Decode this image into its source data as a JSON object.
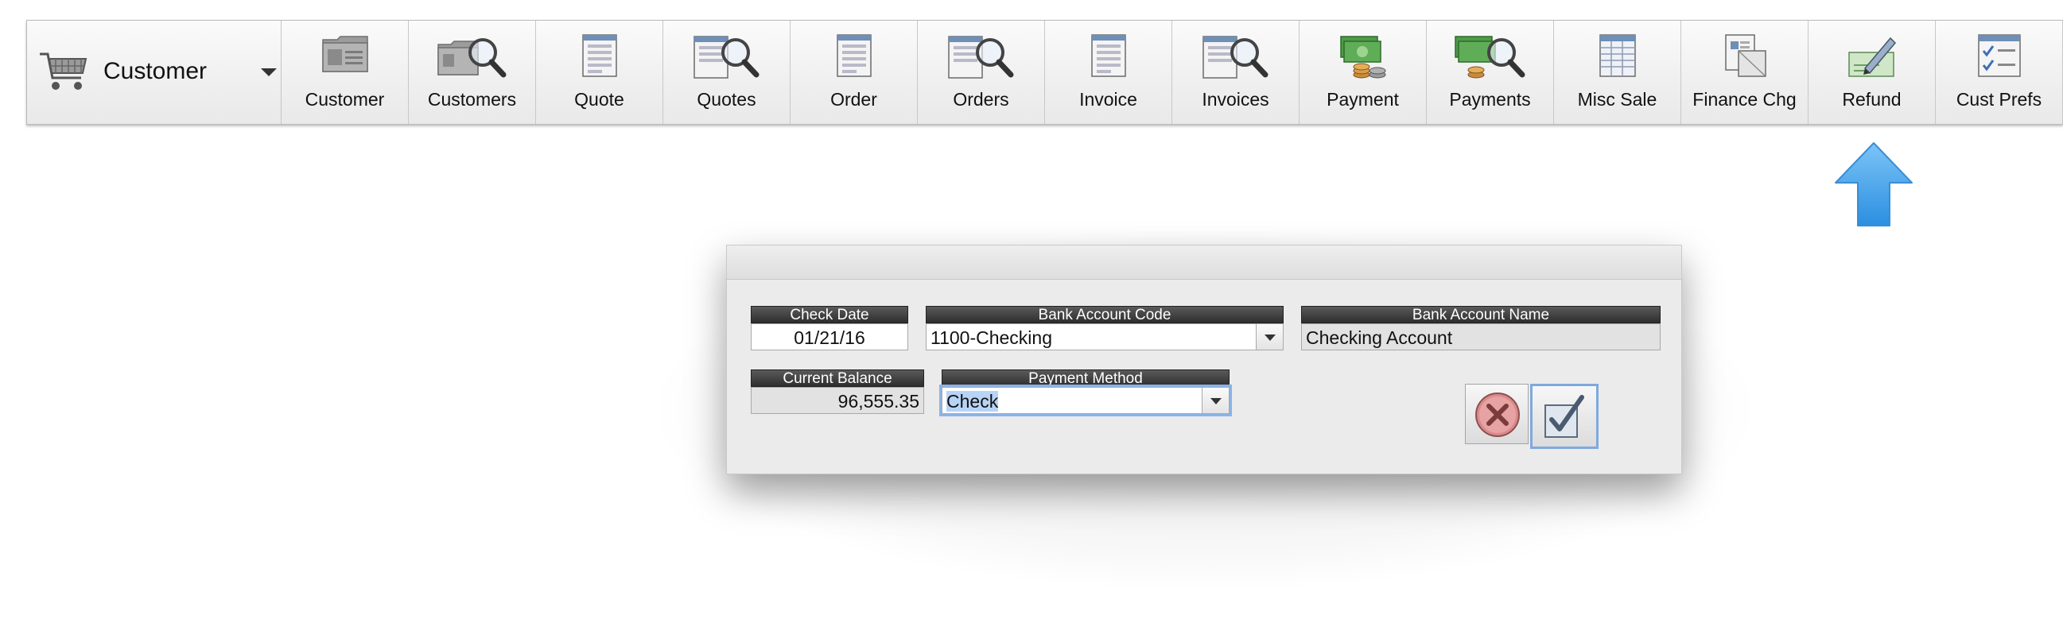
{
  "toolbar": {
    "module": {
      "label": "Customer",
      "icon": "shopping-cart-icon"
    },
    "tools": [
      {
        "label": "Customer",
        "icon": "customer-card-icon"
      },
      {
        "label": "Customers",
        "icon": "customers-search-icon"
      },
      {
        "label": "Quote",
        "icon": "quote-document-icon"
      },
      {
        "label": "Quotes",
        "icon": "quotes-search-icon"
      },
      {
        "label": "Order",
        "icon": "order-document-icon"
      },
      {
        "label": "Orders",
        "icon": "orders-search-icon"
      },
      {
        "label": "Invoice",
        "icon": "invoice-document-icon"
      },
      {
        "label": "Invoices",
        "icon": "invoices-search-icon"
      },
      {
        "label": "Payment",
        "icon": "payment-money-icon"
      },
      {
        "label": "Payments",
        "icon": "payments-search-icon"
      },
      {
        "label": "Misc Sale",
        "icon": "misc-sale-icon"
      },
      {
        "label": "Finance Chg",
        "icon": "finance-charge-icon"
      },
      {
        "label": "Refund",
        "icon": "refund-check-icon"
      },
      {
        "label": "Cust Prefs",
        "icon": "customer-prefs-icon"
      }
    ]
  },
  "pointer": {
    "icon": "blue-up-arrow-icon",
    "color": "#3d9fe6"
  },
  "dialog": {
    "check_date": {
      "label": "Check Date",
      "value": "01/21/16"
    },
    "bank_account_code": {
      "label": "Bank Account Code",
      "value": "1100-Checking"
    },
    "bank_account_name": {
      "label": "Bank Account Name",
      "value": "Checking Account"
    },
    "current_balance": {
      "label": "Current Balance",
      "value": "96,555.35"
    },
    "payment_method": {
      "label": "Payment Method",
      "value": "Check"
    },
    "cancel_icon": "cancel-x-icon",
    "ok_icon": "ok-checkmark-icon"
  },
  "colors": {
    "header_bg": "#3a3a3a",
    "selection": "#b7d3f6",
    "focus_ring": "#8ab3e8",
    "cancel": "#d98b8b"
  }
}
